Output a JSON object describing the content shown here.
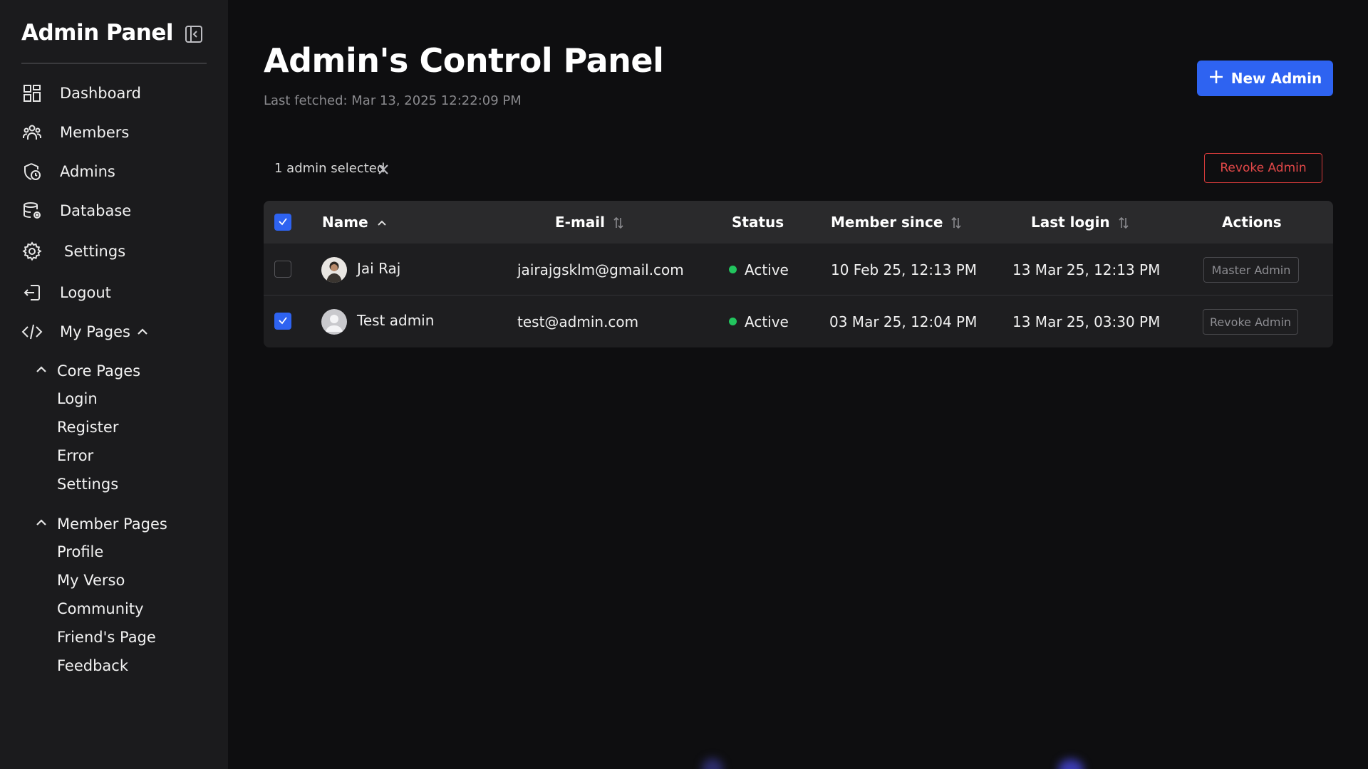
{
  "sidebar": {
    "title": "Admin Panel",
    "nav": [
      {
        "label": "Dashboard",
        "icon": "grid-icon"
      },
      {
        "label": "Members",
        "icon": "users-icon"
      },
      {
        "label": "Admins",
        "icon": "shield-clock-icon"
      },
      {
        "label": "Database",
        "icon": "database-icon"
      },
      {
        "label": "Settings",
        "icon": "gear-icon"
      },
      {
        "label": "Logout",
        "icon": "logout-icon"
      },
      {
        "label": "My Pages",
        "icon": "code-icon"
      }
    ],
    "core_pages": {
      "label": "Core Pages",
      "items": [
        "Login",
        "Register",
        "Error",
        "Settings"
      ]
    },
    "member_pages": {
      "label": "Member Pages",
      "items": [
        "Profile",
        "My Verso",
        "Community",
        "Friend's Page",
        "Feedback"
      ]
    }
  },
  "header": {
    "title": "Admin's Control Panel",
    "last_fetched": "Last fetched: Mar 13, 2025 12:22:09 PM",
    "new_admin_label": "New Admin"
  },
  "selection": {
    "text": "1 admin selected",
    "revoke_label": "Revoke Admin"
  },
  "table": {
    "columns": [
      "Name",
      "E-mail",
      "Status",
      "Member since",
      "Last login",
      "Actions"
    ],
    "rows": [
      {
        "selected": false,
        "name": "Jai Raj",
        "email": "jairajgsklm@gmail.com",
        "status": "Active",
        "member_since": "10 Feb 25, 12:13 PM",
        "last_login": "13 Mar 25, 12:13 PM",
        "action": "Master Admin"
      },
      {
        "selected": true,
        "name": "Test admin",
        "email": "test@admin.com",
        "status": "Active",
        "member_since": "03 Mar 25, 12:04 PM",
        "last_login": "13 Mar 25, 03:30 PM",
        "action": "Revoke Admin"
      }
    ]
  },
  "colors": {
    "accent": "#2e63f1",
    "danger": "#e34848",
    "active": "#22c55e",
    "sidebar_bg": "#1b1b1d",
    "page_bg": "#0e0e10"
  }
}
